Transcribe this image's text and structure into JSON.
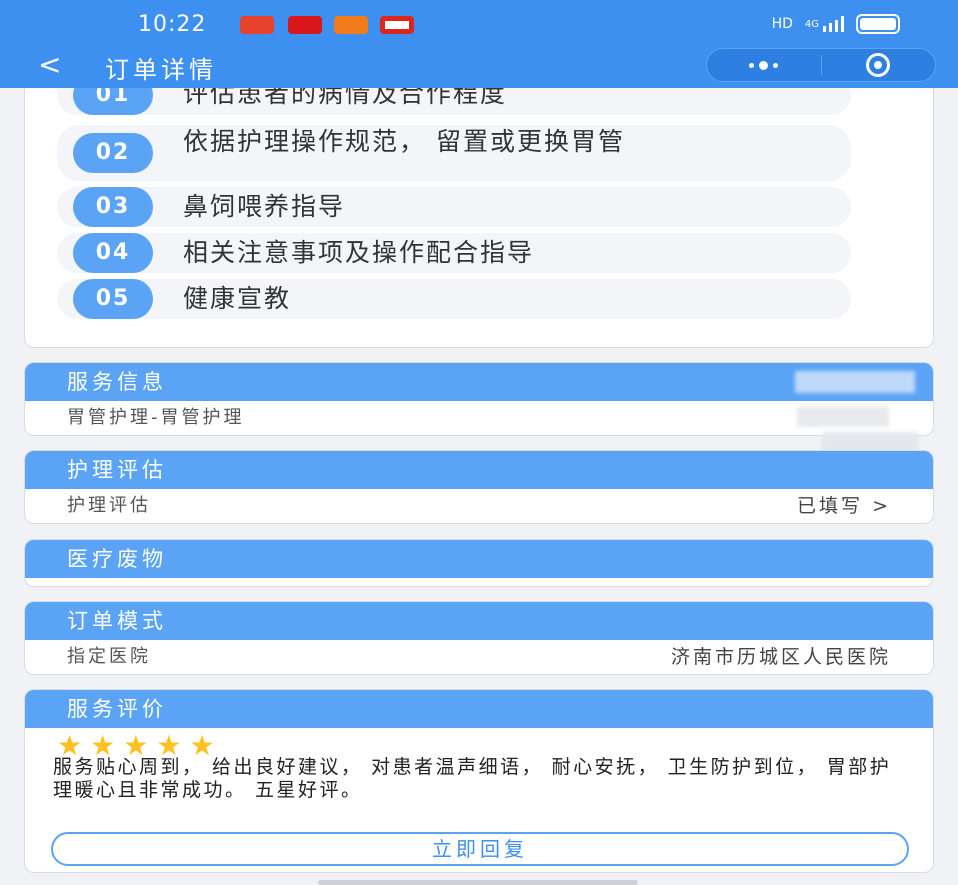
{
  "status_bar": {
    "time": "10:22",
    "network": "HD",
    "signal_label": "4G",
    "notification_colors": [
      "#e8412d",
      "#d9161b",
      "#f27c1c",
      "#e0261b"
    ]
  },
  "header": {
    "back_icon": "chevron-left-icon",
    "title": "订单详情"
  },
  "steps": [
    {
      "num": "01",
      "text": "评估患者的病情及合作程度"
    },
    {
      "num": "02",
      "text": "依据护理操作规范， 留置或更换胃管"
    },
    {
      "num": "03",
      "text": "鼻饲喂养指导"
    },
    {
      "num": "04",
      "text": "相关注意事项及操作配合指导"
    },
    {
      "num": "05",
      "text": "健康宣教"
    }
  ],
  "service_info": {
    "heading": "服务信息",
    "item": "胃管护理-胃管护理"
  },
  "nursing_assessment": {
    "heading": "护理评估",
    "label": "护理评估",
    "status": "已填写 >"
  },
  "medical_waste": {
    "heading": "医疗废物"
  },
  "order_mode": {
    "heading": "订单模式",
    "label": "指定医院",
    "value": "济南市历城区人民医院"
  },
  "review": {
    "heading": "服务评价",
    "stars": 5,
    "text": "服务贴心周到， 给出良好建议， 对患者温声细语， 耐心安抚， 卫生防护到位， 胃部护理暖心且非常成功。 五星好评。",
    "reply_label": "立即回复"
  },
  "colors": {
    "primary": "#3d8ff0",
    "header_blue": "#5aa3f5",
    "star": "#ffc11f"
  }
}
